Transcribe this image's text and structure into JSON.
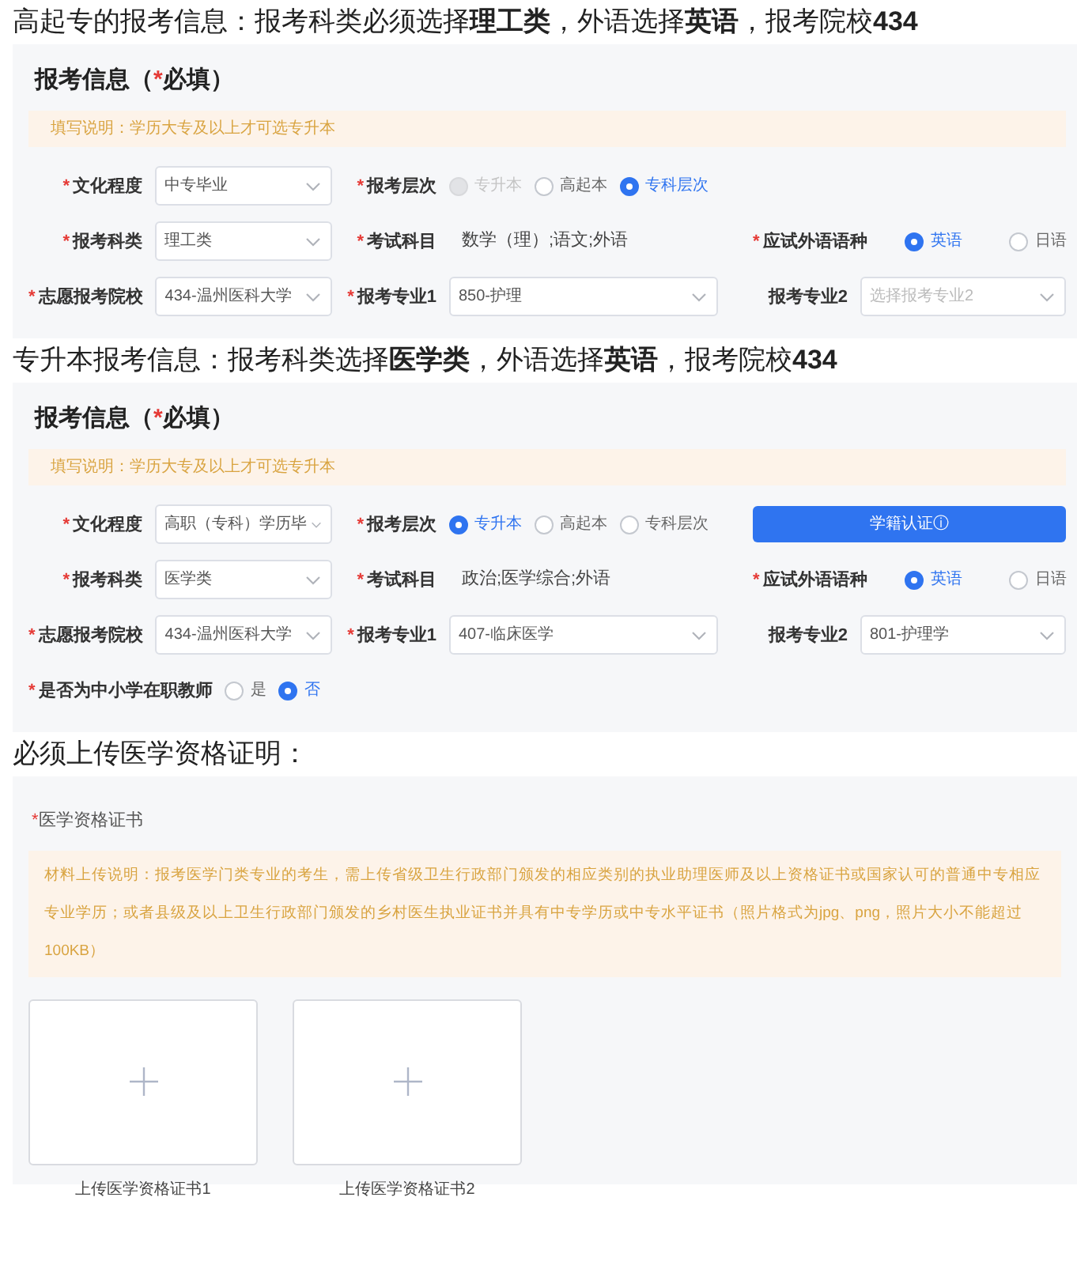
{
  "sections": [
    {
      "kind": "form",
      "heading": "高起专的报考信息：报考科类必须选择**理工类**，外语选择**英语**，报考院校**434**",
      "title_before": "报考信息（",
      "title_mark": "*",
      "title_after": "必填）",
      "notice": "填写说明：学历大专及以上才可选专升本",
      "rows": [
        [
          {
            "kind": "select",
            "mark": "*",
            "label": "文化程度",
            "value": "中专毕业"
          },
          {
            "kind": "radio",
            "mark": "*",
            "label": "报考层次",
            "options": [
              {
                "label": "专升本",
                "selected": false,
                "disabled": true
              },
              {
                "label": "高起本",
                "selected": false,
                "disabled": false
              },
              {
                "label": "专科层次",
                "selected": true,
                "disabled": false
              }
            ]
          }
        ],
        [
          {
            "kind": "select",
            "mark": "*",
            "label": "报考科类",
            "value": "理工类"
          },
          {
            "kind": "text",
            "mark": "*",
            "label": "考试科目",
            "value": "数学（理）;语文;外语"
          },
          {
            "kind": "radio",
            "mark": "*",
            "label": "应试外语语种",
            "options": [
              {
                "label": "英语",
                "selected": true,
                "disabled": false
              },
              {
                "label": "日语",
                "selected": false,
                "disabled": false
              }
            ]
          }
        ],
        [
          {
            "kind": "select",
            "mark": "*",
            "label": "志愿报考院校",
            "value": "434-温州医科大学"
          },
          {
            "kind": "select",
            "mark": "*",
            "label": "报考专业1",
            "value": "850-护理"
          },
          {
            "kind": "select",
            "label": "报考专业2",
            "placeholder": "选择报考专业2"
          }
        ]
      ]
    },
    {
      "kind": "form",
      "heading": "专升本报考信息：报考科类选择**医学类**，外语选择**英语**，报考院校**434**",
      "title_before": "报考信息（",
      "title_mark": "*",
      "title_after": "必填）",
      "notice": "填写说明：学历大专及以上才可选专升本",
      "rows": [
        [
          {
            "kind": "select",
            "mark": "*",
            "label": "文化程度",
            "value": "高职（专科）学历毕"
          },
          {
            "kind": "radio",
            "mark": "*",
            "label": "报考层次",
            "options": [
              {
                "label": "专升本",
                "selected": true,
                "disabled": false
              },
              {
                "label": "高起本",
                "selected": false,
                "disabled": false
              },
              {
                "label": "专科层次",
                "selected": false,
                "disabled": false
              }
            ]
          },
          {
            "kind": "button",
            "label": "学籍认证ⓘ"
          }
        ],
        [
          {
            "kind": "select",
            "mark": "*",
            "label": "报考科类",
            "value": "医学类"
          },
          {
            "kind": "text",
            "mark": "*",
            "label": "考试科目",
            "value": "政治;医学综合;外语"
          },
          {
            "kind": "radio",
            "mark": "*",
            "label": "应试外语语种",
            "options": [
              {
                "label": "英语",
                "selected": true,
                "disabled": false
              },
              {
                "label": "日语",
                "selected": false,
                "disabled": false
              }
            ]
          }
        ],
        [
          {
            "kind": "select",
            "mark": "*",
            "label": "志愿报考院校",
            "value": "434-温州医科大学"
          },
          {
            "kind": "select",
            "mark": "*",
            "label": "报考专业1",
            "value": "407-临床医学"
          },
          {
            "kind": "select",
            "label": "报考专业2",
            "value": "801-护理学"
          }
        ],
        [
          {
            "kind": "radio",
            "mark": "*",
            "label": "是否为中小学在职教师",
            "options": [
              {
                "label": "是",
                "selected": false,
                "disabled": false
              },
              {
                "label": "否",
                "selected": true,
                "disabled": false
              }
            ]
          }
        ]
      ]
    },
    {
      "kind": "upload",
      "heading": "必须上传医学资格证明：",
      "mark": "*",
      "label": "医学资格证书",
      "notice": "材料上传说明：报考医学门类专业的考生，需上传省级卫生行政部门颁发的相应类别的执业助理医师及以上资格证书或国家认可的普通中专相应专业学历；或者县级及以上卫生行政部门颁发的乡村医生执业证书并具有中专学历或中专水平证书（照片格式为jpg、png，照片大小不能超过100KB）",
      "slots": [
        {
          "caption": "上传医学资格证书1"
        },
        {
          "caption": "上传医学资格证书2"
        }
      ]
    }
  ]
}
